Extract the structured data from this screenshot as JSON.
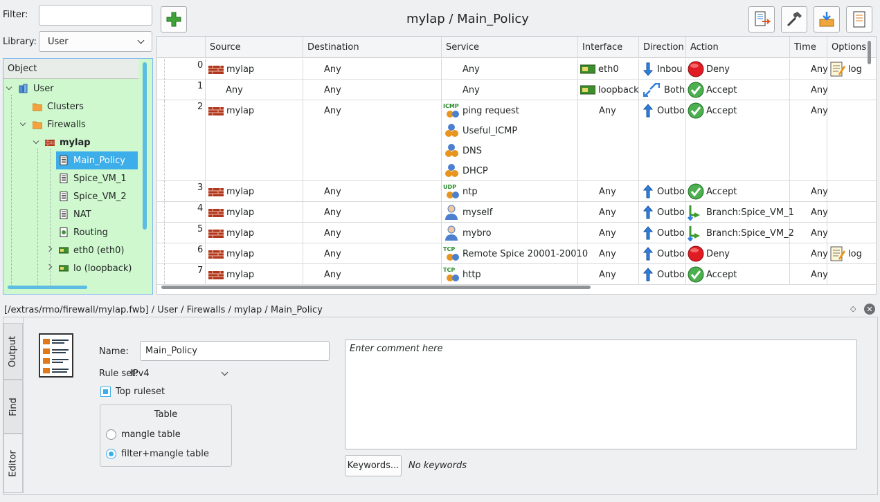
{
  "filter": {
    "label": "Filter:",
    "value": ""
  },
  "library": {
    "label": "Library:",
    "value": "User"
  },
  "toolbar": {
    "title": "mylap / Main_Policy",
    "add_icon": "plus-icon",
    "icons": [
      "compile-icon",
      "hammer-icon",
      "install-icon",
      "inspect-icon"
    ]
  },
  "tree": {
    "header": "Object",
    "items": [
      {
        "label": "User",
        "icon": "library-icon",
        "bold": false
      },
      {
        "label": "Clusters",
        "icon": "folder-icon",
        "bold": false
      },
      {
        "label": "Firewalls",
        "icon": "folder-icon",
        "bold": false
      },
      {
        "label": "mylap",
        "icon": "firewall-icon",
        "bold": true
      },
      {
        "label": "Main_Policy",
        "icon": "policy-icon",
        "bold": false
      },
      {
        "label": "Spice_VM_1",
        "icon": "policy-icon",
        "bold": false
      },
      {
        "label": "Spice_VM_2",
        "icon": "policy-icon",
        "bold": false
      },
      {
        "label": "NAT",
        "icon": "policy-icon",
        "bold": false
      },
      {
        "label": "Routing",
        "icon": "routing-icon",
        "bold": false
      },
      {
        "label": "eth0 (eth0)",
        "icon": "interface-icon",
        "bold": false
      },
      {
        "label": "lo (loopback)",
        "icon": "interface-icon",
        "bold": false
      }
    ]
  },
  "columns": [
    "Source",
    "Destination",
    "Service",
    "Interface",
    "Direction",
    "Action",
    "Time",
    "Options"
  ],
  "rules": [
    {
      "num": "0",
      "source": "mylap",
      "destination": "Any",
      "service": [
        {
          "name": "Any",
          "icon": ""
        }
      ],
      "interface": "eth0",
      "direction": "Inbou",
      "action": "Deny",
      "time": "Any",
      "options": "log"
    },
    {
      "num": "1",
      "source": "Any",
      "destination": "Any",
      "service": [
        {
          "name": "Any",
          "icon": ""
        }
      ],
      "interface": "loopback",
      "direction": "Both",
      "action": "Accept",
      "time": "Any",
      "options": ""
    },
    {
      "num": "2",
      "source": "mylap",
      "destination": "Any",
      "service": [
        {
          "name": "ping request",
          "icon": "ICMP"
        },
        {
          "name": "Useful_ICMP",
          "icon": "group"
        },
        {
          "name": "DNS",
          "icon": "group"
        },
        {
          "name": "DHCP",
          "icon": "group"
        }
      ],
      "interface": "Any",
      "direction": "Outbo",
      "action": "Accept",
      "time": "Any",
      "options": ""
    },
    {
      "num": "3",
      "source": "mylap",
      "destination": "Any",
      "service": [
        {
          "name": "ntp",
          "icon": "UDP"
        }
      ],
      "interface": "Any",
      "direction": "Outbo",
      "action": "Accept",
      "time": "Any",
      "options": ""
    },
    {
      "num": "4",
      "source": "mylap",
      "destination": "Any",
      "service": [
        {
          "name": "myself",
          "icon": "user"
        }
      ],
      "interface": "Any",
      "direction": "Outbo",
      "action": "Branch:Spice_VM_1",
      "time": "Any",
      "options": ""
    },
    {
      "num": "5",
      "source": "mylap",
      "destination": "Any",
      "service": [
        {
          "name": "mybro",
          "icon": "user"
        }
      ],
      "interface": "Any",
      "direction": "Outbo",
      "action": "Branch:Spice_VM_2",
      "time": "Any",
      "options": ""
    },
    {
      "num": "6",
      "source": "mylap",
      "destination": "Any",
      "service": [
        {
          "name": "Remote Spice 20001-20010",
          "icon": "TCP"
        }
      ],
      "interface": "Any",
      "direction": "Outbo",
      "action": "Deny",
      "time": "Any",
      "options": "log"
    },
    {
      "num": "7",
      "source": "mylap",
      "destination": "Any",
      "service": [
        {
          "name": "http",
          "icon": "TCP"
        }
      ],
      "interface": "Any",
      "direction": "Outbo",
      "action": "Accept",
      "time": "Any",
      "options": ""
    }
  ],
  "editor": {
    "path": "[/extras/rmo/firewall/mylap.fwb] / User / Firewalls / mylap / Main_Policy",
    "tabs": [
      "Output",
      "Find",
      "Editor"
    ],
    "name_label": "Name:",
    "name_value": "Main_Policy",
    "ruleset_label": "Rule set:",
    "ruleset_value": "IPv4",
    "top_ruleset": "Top ruleset",
    "table_group": "Table",
    "radio_mangle": "mangle table",
    "radio_filter": "filter+mangle table",
    "comment_placeholder": "Enter comment here",
    "keywords_button": "Keywords...",
    "keywords_value": "No keywords"
  },
  "colors": {
    "accent": "#3daee9",
    "tree_bg": "#cff8ce",
    "deny": "#e01b24",
    "accept": "#4caf50",
    "arrow": "#2f7fdd"
  }
}
